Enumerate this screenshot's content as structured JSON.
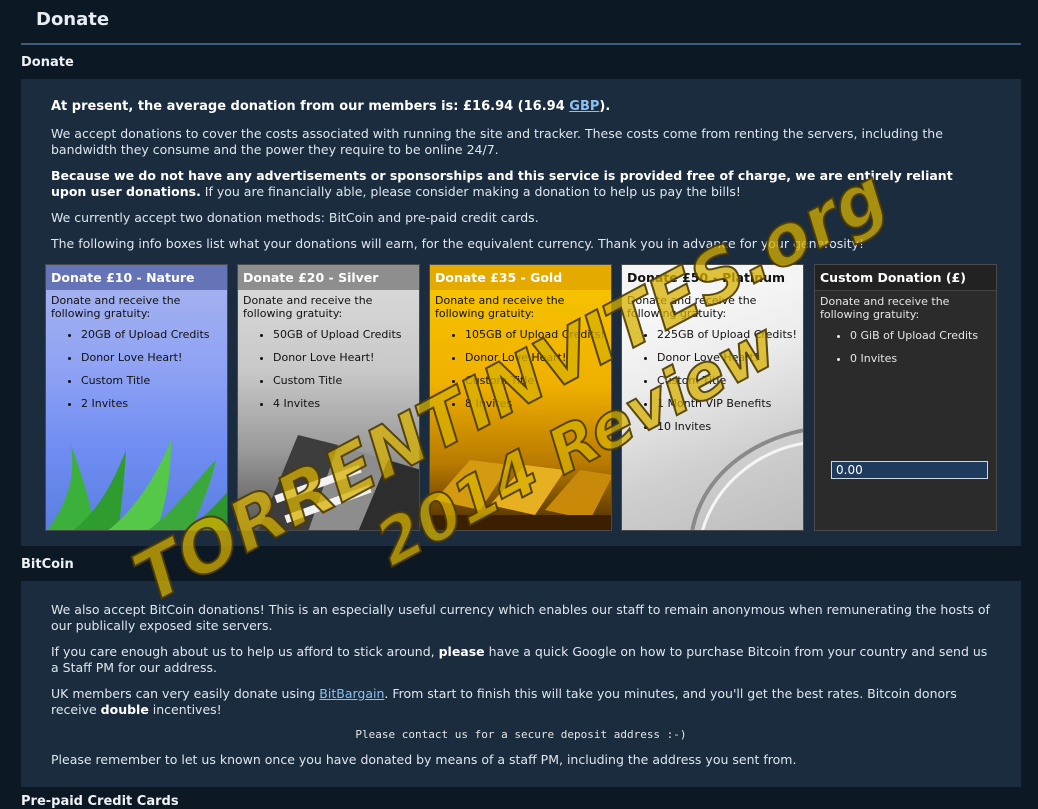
{
  "page": {
    "title": "Donate"
  },
  "donate": {
    "heading": "Donate",
    "average_prefix": "At present, the average donation from our members is: £16.94 (16.94 ",
    "average_currency": "GBP",
    "average_suffix": ").",
    "para1": "We accept donations to cover the costs associated with running the site and tracker. These costs come from renting the servers, including the bandwidth they consume and the power they require to be online 24/7.",
    "para2_bold": "Because we do not have any advertisements or sponsorships and this service is provided free of charge, we are entirely reliant upon user donations.",
    "para2_rest": " If you are financially able, please consider making a donation to help us pay the bills!",
    "para3": "We currently accept two donation methods: BitCoin and pre-paid credit cards.",
    "para4": "The following info boxes list what your donations will earn, for the equivalent currency. Thank you in advance for your generosity!"
  },
  "tiers": [
    {
      "title": "Donate £10 - Nature",
      "intro": "Donate and receive the following gratuity:",
      "items": [
        "20GB of Upload Credits",
        "Donor Love Heart!",
        "Custom Title",
        "2 Invites"
      ]
    },
    {
      "title": "Donate £20 - Silver",
      "intro": "Donate and receive the following gratuity:",
      "items": [
        "50GB of Upload Credits",
        "Donor Love Heart!",
        "Custom Title",
        "4 Invites"
      ]
    },
    {
      "title": "Donate £35 - Gold",
      "intro": "Donate and receive the following gratuity:",
      "items": [
        "105GB of Upload Credits!",
        "Donor Love Heart!",
        "Custom Title",
        "8 Invites"
      ]
    },
    {
      "title": "Donate £50 - Platinum",
      "intro": "Donate and receive the following gratuity:",
      "items": [
        "225GB of Upload Credits!",
        "Donor Love Heart!",
        "Custom Title",
        "1 Month VIP Benefits",
        "10 Invites"
      ]
    },
    {
      "title": "Custom Donation (£)",
      "intro": "Donate and receive the following gratuity:",
      "items": [
        "0 GiB of Upload Credits",
        "0 Invites"
      ],
      "amount": "0.00"
    }
  ],
  "bitcoin": {
    "heading": "BitCoin",
    "para1": "We also accept BitCoin donations! This is an especially useful currency which enables our staff to remain anonymous when remunerating the hosts of our publically exposed site servers.",
    "para2_a": "If you care enough about us to help us afford to stick around, ",
    "para2_b": "please",
    "para2_c": " have a quick Google on how to purchase Bitcoin from your country and send us a Staff PM for our address.",
    "para3_a": "UK members can very easily donate using ",
    "para3_link": "BitBargain",
    "para3_b": ". From start to finish this will take you minutes, and you'll get the best rates. Bitcoin donors receive ",
    "para3_bold": "double",
    "para3_c": " incentives!",
    "contact": "Please contact us for a secure deposit address :-)",
    "para4": "Please remember to let us known once you have donated by means of a staff PM, including the address you sent from."
  },
  "next_heading": "Pre-paid Credit Cards",
  "watermark": {
    "line1": "TORRENTINVITES.org",
    "line2": "2014 Review"
  },
  "colors": {
    "accent": "#3d5b7c",
    "link": "#8cc0f0",
    "panel": "#1a2c3e",
    "background": "#0c1824"
  }
}
